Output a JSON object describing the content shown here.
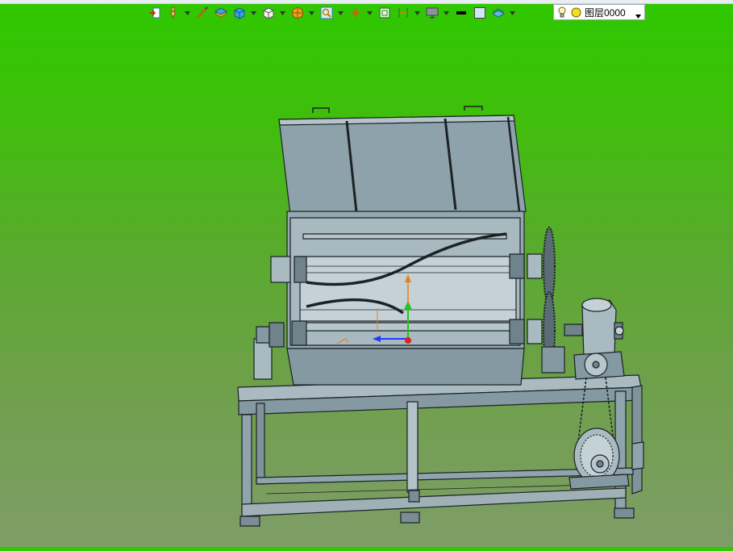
{
  "toolbar": {
    "layer_name": "图层0000"
  },
  "colors": {
    "background_top": "#2fc800",
    "background_bottom": "#7f9d68",
    "model_fill": "#8fa4ad",
    "model_edge": "#1b2226",
    "axis_x": "#1e3cff",
    "axis_y": "#1ec81e",
    "axis_z": "#e8801a"
  },
  "icons": [
    "import-icon",
    "pen-tool-icon",
    "sketch-icon",
    "layers-3d-icon",
    "solid-cube-icon",
    "view-cube-icon",
    "sphere-render-icon",
    "zoom-icon",
    "move-axis-icon",
    "frame-icon",
    "section-icon",
    "display-icon",
    "line-color-icon",
    "fill-color-icon",
    "surface-icon",
    "bulb-icon",
    "sun-icon"
  ]
}
